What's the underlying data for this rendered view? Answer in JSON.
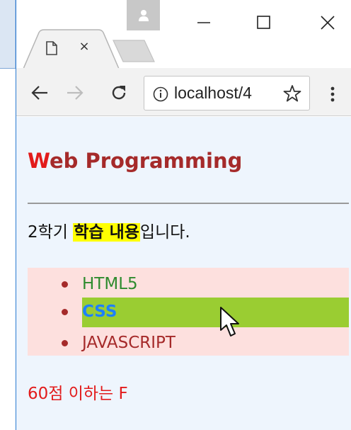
{
  "browser": {
    "tab": {
      "close_glyph": "×"
    },
    "window_controls": {
      "minimize": "minimize-icon",
      "maximize": "maximize-icon",
      "close": "close-icon"
    },
    "toolbar": {
      "url": "localhost/4",
      "icons": [
        "back-arrow-icon",
        "forward-arrow-icon",
        "reload-icon",
        "info-icon",
        "star-icon",
        "menu-dots-icon"
      ]
    }
  },
  "page": {
    "heading_first": "W",
    "heading_rest": "eb Programming",
    "paragraph": {
      "before": "2학기 ",
      "highlight": "학습 내용",
      "after": "입니다."
    },
    "list_items": [
      "HTML5",
      "CSS",
      "JAVASCRIPT"
    ],
    "footer": "60점 이하는 F"
  },
  "colors": {
    "heading": "#a52a2a",
    "heading_first_letter": "#e21b1b",
    "list_background": "#fde0de",
    "hover_highlight": "#9acd32",
    "css_text": "#1e80ff",
    "html5_text": "#2e8b2e",
    "footer_text": "#e21b1b",
    "page_background": "#eef5fd"
  }
}
